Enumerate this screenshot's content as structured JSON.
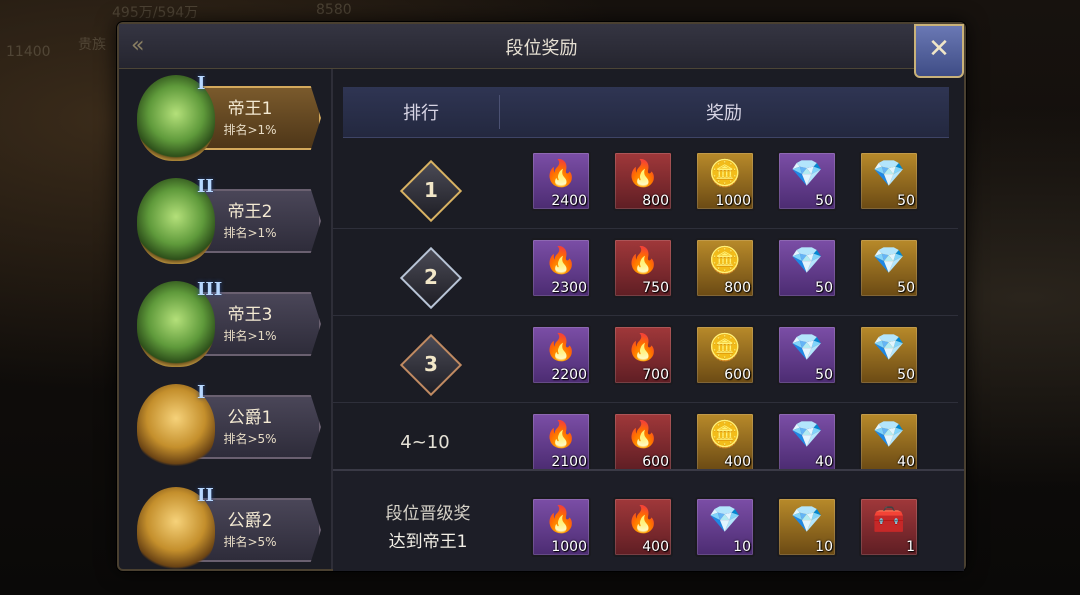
{
  "window": {
    "title": "段位奖励"
  },
  "background": {
    "hud_left": "495万/594万",
    "hud_mid": "8580",
    "hud_left2": "贵族",
    "hud_left3": "11400"
  },
  "sidebar": {
    "tiers": [
      {
        "name": "帝王1",
        "sub": "排名>1%",
        "roman": "I",
        "active": true,
        "emblem": "jade"
      },
      {
        "name": "帝王2",
        "sub": "排名>1%",
        "roman": "II",
        "active": false,
        "emblem": "jade"
      },
      {
        "name": "帝王3",
        "sub": "排名>1%",
        "roman": "III",
        "active": false,
        "emblem": "jade"
      },
      {
        "name": "公爵1",
        "sub": "排名>5%",
        "roman": "I",
        "active": false,
        "emblem": "gold"
      },
      {
        "name": "公爵2",
        "sub": "排名>5%",
        "roman": "II",
        "active": false,
        "emblem": "gold"
      }
    ]
  },
  "table": {
    "header_rank": "排行",
    "header_reward": "奖励",
    "rows": [
      {
        "rank": "1",
        "badge": "gold",
        "items": [
          {
            "icon": "fire-scroll-icon",
            "glyph": "🔥",
            "color": "purple",
            "qty": "2400"
          },
          {
            "icon": "fire-orb-icon",
            "glyph": "🔥",
            "color": "red",
            "qty": "800"
          },
          {
            "icon": "gold-ingot-icon",
            "glyph": "🪙",
            "color": "gold",
            "qty": "1000"
          },
          {
            "icon": "blue-potion-icon",
            "glyph": "💎",
            "color": "purple",
            "qty": "50"
          },
          {
            "icon": "pink-potion-icon",
            "glyph": "💎",
            "color": "gold",
            "qty": "50"
          }
        ]
      },
      {
        "rank": "2",
        "badge": "silver",
        "items": [
          {
            "icon": "fire-scroll-icon",
            "glyph": "🔥",
            "color": "purple",
            "qty": "2300"
          },
          {
            "icon": "fire-orb-icon",
            "glyph": "🔥",
            "color": "red",
            "qty": "750"
          },
          {
            "icon": "gold-ingot-icon",
            "glyph": "🪙",
            "color": "gold",
            "qty": "800"
          },
          {
            "icon": "blue-potion-icon",
            "glyph": "💎",
            "color": "purple",
            "qty": "50"
          },
          {
            "icon": "pink-potion-icon",
            "glyph": "💎",
            "color": "gold",
            "qty": "50"
          }
        ]
      },
      {
        "rank": "3",
        "badge": "bronze",
        "items": [
          {
            "icon": "fire-scroll-icon",
            "glyph": "🔥",
            "color": "purple",
            "qty": "2200"
          },
          {
            "icon": "fire-orb-icon",
            "glyph": "🔥",
            "color": "red",
            "qty": "700"
          },
          {
            "icon": "gold-ingot-icon",
            "glyph": "🪙",
            "color": "gold",
            "qty": "600"
          },
          {
            "icon": "blue-potion-icon",
            "glyph": "💎",
            "color": "purple",
            "qty": "50"
          },
          {
            "icon": "pink-potion-icon",
            "glyph": "💎",
            "color": "gold",
            "qty": "50"
          }
        ]
      },
      {
        "rank": "4~10",
        "badge": "text",
        "items": [
          {
            "icon": "fire-scroll-icon",
            "glyph": "🔥",
            "color": "purple",
            "qty": "2100"
          },
          {
            "icon": "fire-orb-icon",
            "glyph": "🔥",
            "color": "red",
            "qty": "600"
          },
          {
            "icon": "gold-ingot-icon",
            "glyph": "🪙",
            "color": "gold",
            "qty": "400"
          },
          {
            "icon": "blue-potion-icon",
            "glyph": "💎",
            "color": "purple",
            "qty": "40"
          },
          {
            "icon": "pink-potion-icon",
            "glyph": "💎",
            "color": "gold",
            "qty": "40"
          }
        ]
      }
    ]
  },
  "footer": {
    "title": "段位晋级奖",
    "condition": "达到帝王1",
    "items": [
      {
        "icon": "fire-scroll-icon",
        "glyph": "🔥",
        "color": "purple",
        "qty": "1000"
      },
      {
        "icon": "fire-orb-icon",
        "glyph": "🔥",
        "color": "red",
        "qty": "400"
      },
      {
        "icon": "blue-potion-icon",
        "glyph": "💎",
        "color": "purple",
        "qty": "10"
      },
      {
        "icon": "pink-potion-icon",
        "glyph": "💎",
        "color": "gold",
        "qty": "10"
      },
      {
        "icon": "treasure-chest-icon",
        "glyph": "🧰",
        "color": "red",
        "qty": "1"
      }
    ]
  }
}
